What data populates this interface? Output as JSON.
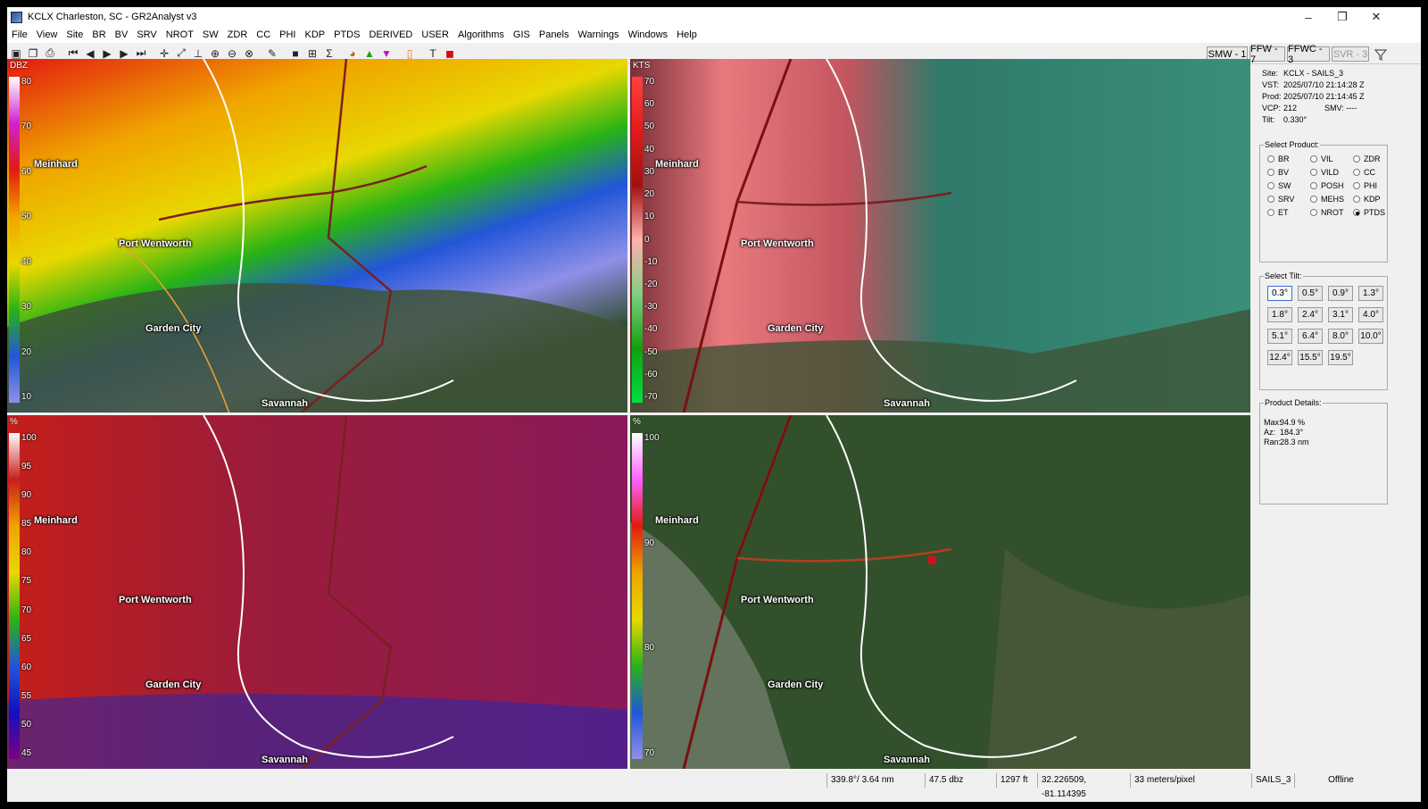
{
  "window": {
    "title": "KCLX Charleston, SC - GR2Analyst v3",
    "minimize": "–",
    "maximize": "❐",
    "close": "✕"
  },
  "menu": [
    "File",
    "View",
    "Site",
    "BR",
    "BV",
    "SRV",
    "NROT",
    "SW",
    "ZDR",
    "CC",
    "PHI",
    "KDP",
    "PTDS",
    "DERIVED",
    "USER",
    "Algorithms",
    "GIS",
    "Panels",
    "Warnings",
    "Windows",
    "Help"
  ],
  "toolbar": {
    "icons": [
      "open-icon",
      "copy-icon",
      "print-icon",
      "skip-first-icon",
      "step-back-icon",
      "play-icon",
      "step-forward-icon",
      "skip-last-icon",
      "crosshair-icon",
      "zoom-in-icon",
      "measure-icon",
      "zoom-icon",
      "zoom-out-icon",
      "target-icon",
      "pencil-icon",
      "stop-icon",
      "grid-icon",
      "sum-icon",
      "storm-icon",
      "triangle-up-icon",
      "triangle-down-icon",
      "placefile-icon",
      "text-icon",
      "record-icon"
    ],
    "warnings": [
      {
        "label": "SMW - 1",
        "disabled": false
      },
      {
        "label": "FFW - 7",
        "disabled": false
      },
      {
        "label": "FFWC - 3",
        "disabled": false
      },
      {
        "label": "SVR - 3",
        "disabled": true
      }
    ],
    "filter_icon": "filter-icon"
  },
  "panels": [
    {
      "unit": "DBZ",
      "ticks": [
        "80",
        "70",
        "60",
        "50",
        "40",
        "30",
        "20",
        "10"
      ],
      "product": "reflectivity"
    },
    {
      "unit": "KTS",
      "ticks": [
        "70",
        "60",
        "50",
        "40",
        "30",
        "20",
        "10",
        "0",
        "-10",
        "-20",
        "-30",
        "-40",
        "-50",
        "-60",
        "-70"
      ],
      "product": "velocity"
    },
    {
      "unit": "%",
      "ticks": [
        "100",
        "95",
        "90",
        "85",
        "80",
        "75",
        "70",
        "65",
        "60",
        "55",
        "50",
        "45"
      ],
      "product": "correlation"
    },
    {
      "unit": "%",
      "ticks": [
        "100",
        "90",
        "80",
        "70"
      ],
      "product": "ptds"
    }
  ],
  "cities": [
    "Meinhard",
    "Port Wentworth",
    "Garden City",
    "Savannah"
  ],
  "info": {
    "site_label": "Site:",
    "site": "KCLX - SAILS_3",
    "vst_label": "VST:",
    "vst": "2025/07/10  21:14:28 Z",
    "prod_label": "Prod:",
    "prod": "2025/07/10  21:14:45 Z",
    "vcp_label": "VCP:",
    "vcp": "212",
    "smv_label": "SMV:",
    "smv": "----",
    "tilt_label": "Tilt:",
    "tilt": "0.330°"
  },
  "select_product": {
    "caption": "Select Product:",
    "options": [
      {
        "label": "BR",
        "selected": false
      },
      {
        "label": "VIL",
        "selected": false
      },
      {
        "label": "ZDR",
        "selected": false
      },
      {
        "label": "BV",
        "selected": false
      },
      {
        "label": "VILD",
        "selected": false
      },
      {
        "label": "CC",
        "selected": false
      },
      {
        "label": "SW",
        "selected": false
      },
      {
        "label": "POSH",
        "selected": false
      },
      {
        "label": "PHI",
        "selected": false
      },
      {
        "label": "SRV",
        "selected": false
      },
      {
        "label": "MEHS",
        "selected": false
      },
      {
        "label": "KDP",
        "selected": false
      },
      {
        "label": "ET",
        "selected": false
      },
      {
        "label": "NROT",
        "selected": false
      },
      {
        "label": "PTDS",
        "selected": true
      }
    ]
  },
  "select_tilt": {
    "caption": "Select Tilt:",
    "tilts": [
      "0.3°",
      "0.5°",
      "0.9°",
      "1.3°",
      "1.8°",
      "2.4°",
      "3.1°",
      "4.0°",
      "5.1°",
      "6.4°",
      "8.0°",
      "10.0°",
      "12.4°",
      "15.5°",
      "19.5°"
    ],
    "selected": "0.3°"
  },
  "product_details": {
    "caption": "Product Details:",
    "max_label": "Max:",
    "max": "94.9 %",
    "az_label": "Az:",
    "az": "184.3°",
    "ran_label": "Ran:",
    "ran": "28.3 nm"
  },
  "status": {
    "position": "339.8°/ 3.64 nm",
    "value": "47.5 dbz",
    "height": "1297 ft",
    "latlon": "32.226509, -81.114395",
    "scale": "33 meters/pixel",
    "vcp_mode": "SAILS_3",
    "connection": "Offline"
  }
}
